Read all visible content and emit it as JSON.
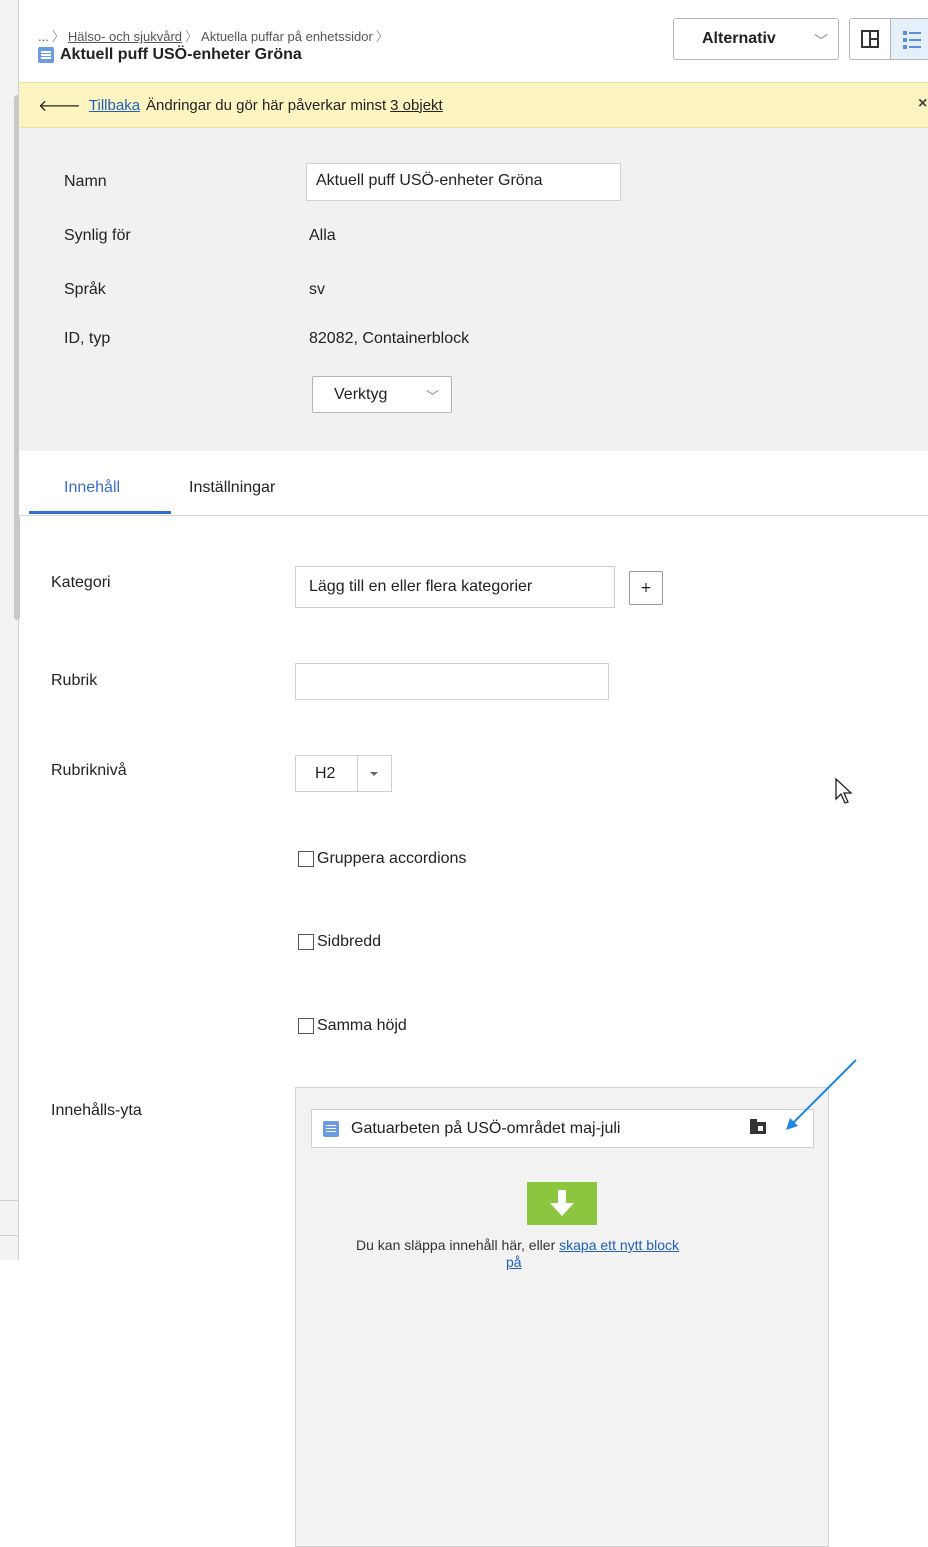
{
  "header": {
    "breadcrumb": [
      "...",
      "Hälso- och sjukvård",
      "Aktuella puffar på enhetssidor"
    ],
    "title": "Aktuell puff USÖ-enheter Gröna",
    "options_label": "Alternativ"
  },
  "notice": {
    "back_label": "Tillbaka",
    "text": "Ändringar du gör här påverkar minst",
    "link": "3 objekt",
    "close": "×"
  },
  "properties": {
    "name_label": "Namn",
    "name_value": "Aktuell puff USÖ-enheter Gröna",
    "visible_label": "Synlig för",
    "visible_value": "Alla",
    "language_label": "Språk",
    "language_value": "sv",
    "id_label": "ID, typ",
    "id_value": "82082, Containerblock",
    "tools_label": "Verktyg"
  },
  "tabs": [
    {
      "label": "Innehåll",
      "active": true
    },
    {
      "label": "Inställningar",
      "active": false
    }
  ],
  "form": {
    "category_label": "Kategori",
    "category_placeholder": "Lägg till en eller flera kategorier",
    "add_label": "+",
    "heading_label": "Rubrik",
    "heading_value": "",
    "heading_level_label": "Rubriknivå",
    "heading_level_value": "H2",
    "checkboxes": [
      {
        "label": "Gruppera accordions",
        "checked": false
      },
      {
        "label": "Sidbredd",
        "checked": false
      },
      {
        "label": "Samma höjd",
        "checked": false
      }
    ],
    "content_area_label": "Innehålls-yta",
    "content_item": "Gatuarbeten på USÖ-området maj-juli",
    "drop_text": "Du kan släppa innehåll här, eller",
    "drop_link": "skapa ett nytt block",
    "drop_link_continuation": "på"
  },
  "colors": {
    "accent": "#2f6fd0",
    "notice_bg": "#fdf5c1",
    "drop_green": "#8cc63f",
    "annotation_arrow": "#1e88e5"
  },
  "icons": [
    "document-icon",
    "split-view-icon",
    "list-view-icon",
    "back-arrow-icon",
    "close-icon",
    "chevron-down-icon",
    "folder-icon",
    "drop-arrow-icon",
    "mouse-cursor-icon"
  ]
}
